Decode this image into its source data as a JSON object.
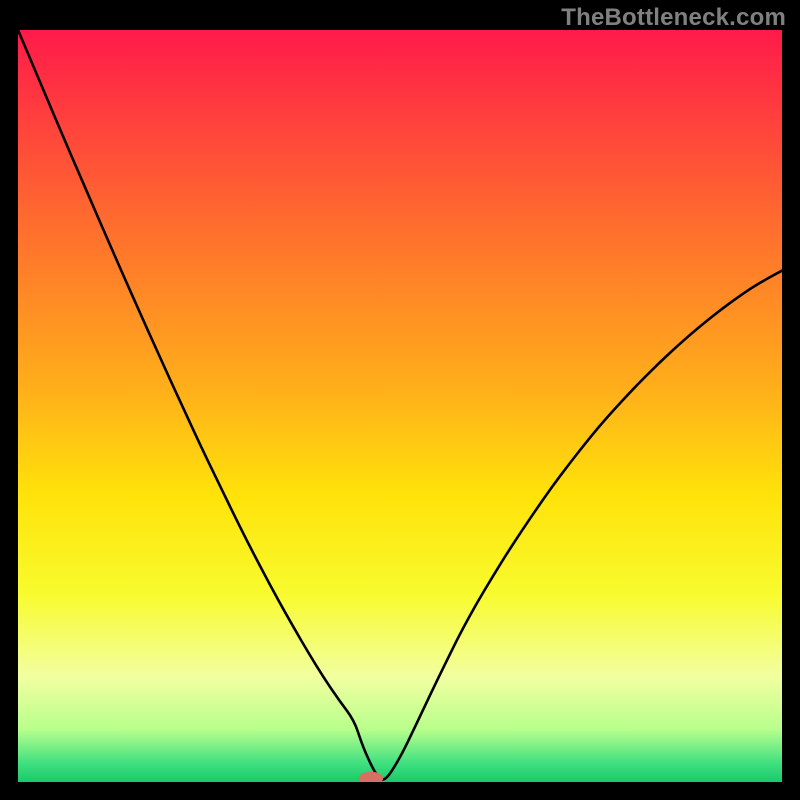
{
  "watermark": "TheBottleneck.com",
  "chart_data": {
    "type": "line",
    "title": "",
    "xlabel": "",
    "ylabel": "",
    "xlim": [
      0,
      100
    ],
    "ylim": [
      0,
      100
    ],
    "x": [
      0,
      2,
      4,
      6,
      8,
      10,
      12,
      14,
      16,
      18,
      20,
      22,
      24,
      26,
      28,
      30,
      32,
      34,
      36,
      38,
      40,
      42,
      44,
      45,
      46,
      47,
      48,
      50,
      52,
      54,
      56,
      58,
      60,
      62,
      64,
      66,
      68,
      70,
      72,
      74,
      76,
      78,
      80,
      82,
      84,
      86,
      88,
      90,
      92,
      94,
      96,
      98,
      100
    ],
    "values": [
      100,
      95.2,
      90.4,
      85.6,
      80.9,
      76.2,
      71.5,
      66.9,
      62.3,
      57.8,
      53.3,
      48.9,
      44.5,
      40.3,
      36.1,
      32.0,
      28.1,
      24.3,
      20.7,
      17.2,
      13.9,
      10.9,
      8.2,
      5.1,
      2.7,
      0.8,
      0.0,
      3.2,
      7.4,
      11.7,
      15.9,
      20.0,
      23.7,
      27.1,
      30.4,
      33.5,
      36.5,
      39.4,
      42.1,
      44.7,
      47.2,
      49.5,
      51.7,
      53.8,
      55.8,
      57.7,
      59.5,
      61.2,
      62.8,
      64.3,
      65.7,
      66.9,
      68.0
    ],
    "background_gradient": {
      "stops": [
        {
          "pos": 0.0,
          "color": "#ff1a4a"
        },
        {
          "pos": 0.25,
          "color": "#ff6a2f"
        },
        {
          "pos": 0.48,
          "color": "#ffb01a"
        },
        {
          "pos": 0.62,
          "color": "#ffe30a"
        },
        {
          "pos": 0.75,
          "color": "#f8fb2e"
        },
        {
          "pos": 0.86,
          "color": "#f2ffa0"
        },
        {
          "pos": 0.93,
          "color": "#b8ff8c"
        },
        {
          "pos": 0.975,
          "color": "#40e080"
        },
        {
          "pos": 1.0,
          "color": "#18c96a"
        }
      ]
    },
    "marker": {
      "x": 46.2,
      "y": 0.0,
      "color": "#d86f63",
      "rx": 1.6,
      "ry": 0.85
    },
    "curve_color": "#000000",
    "curve_width": 2.6
  }
}
